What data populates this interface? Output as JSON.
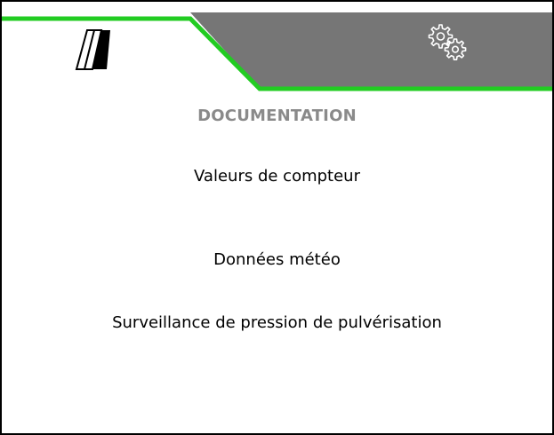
{
  "tabs": [
    {
      "name": "sprayer",
      "icon": "sprayer-icon",
      "active": true
    },
    {
      "name": "settings",
      "icon": "gears-icon",
      "active": false
    }
  ],
  "colors": {
    "accent": "#22cc22",
    "inactive_tab": "#767676",
    "title": "#8a8a8a"
  },
  "main": {
    "title": "DOCUMENTATION",
    "items": [
      {
        "label": "Valeurs de compteur"
      },
      {
        "label": "Données météo"
      },
      {
        "label": "Surveillance de pression de pulvérisation"
      }
    ]
  }
}
